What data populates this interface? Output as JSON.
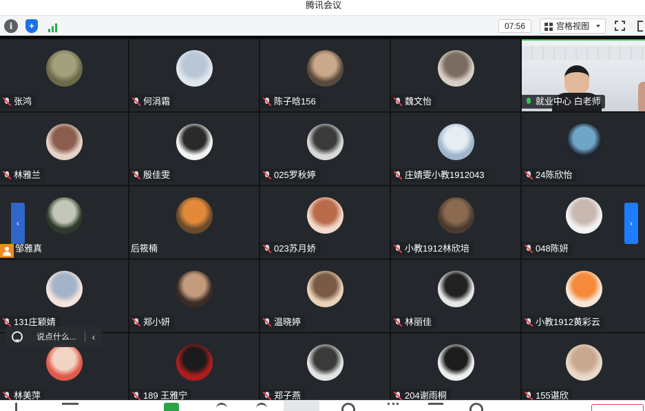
{
  "window": {
    "title": "腾讯会议"
  },
  "toolbar": {
    "timer": "07:56",
    "view_label": "宫格视图",
    "icons": [
      "info-icon",
      "shield-icon",
      "signal-icon",
      "grid-icon",
      "fullscreen-icon"
    ]
  },
  "participants": [
    {
      "name": "张鸿",
      "muted": true
    },
    {
      "name": "何涓霜",
      "muted": true
    },
    {
      "name": "陈子晗156",
      "muted": true
    },
    {
      "name": "魏文怡",
      "muted": true
    },
    {
      "name": "就业中心 白老师",
      "muted": false,
      "video": true
    },
    {
      "name": "林雅兰",
      "muted": true
    },
    {
      "name": "殷佳雯",
      "muted": true
    },
    {
      "name": "025罗秋婷",
      "muted": true
    },
    {
      "name": "庄婧雯小教1912043",
      "muted": true
    },
    {
      "name": "24陈欣怡",
      "muted": true
    },
    {
      "name": "邹雅真",
      "muted": false
    },
    {
      "name": "后筱楠",
      "muted": false
    },
    {
      "name": "023苏月娇",
      "muted": true
    },
    {
      "name": "小教1912林欣培",
      "muted": true
    },
    {
      "name": "048陈妍",
      "muted": true
    },
    {
      "name": "131庄颖婧",
      "muted": true
    },
    {
      "name": "郑小妍",
      "muted": true
    },
    {
      "name": "温晓婷",
      "muted": true
    },
    {
      "name": "林丽佳",
      "muted": true
    },
    {
      "name": "小教1912黄彩云",
      "muted": true
    },
    {
      "name": "林美萍",
      "muted": true
    },
    {
      "name": "189 王雅宁",
      "muted": true
    },
    {
      "name": "郑子燕",
      "muted": true
    },
    {
      "name": "204谢雨桐",
      "muted": true
    },
    {
      "name": "155谌欣",
      "muted": true
    }
  ],
  "chat": {
    "placeholder": "说点什么..."
  },
  "nav": {
    "prev": "‹",
    "next": "›"
  },
  "colors": {
    "accent": "#1e7cff",
    "muted_mic": "#e8424a",
    "active_mic": "#35c35a",
    "tile_bg": "#24282d"
  }
}
